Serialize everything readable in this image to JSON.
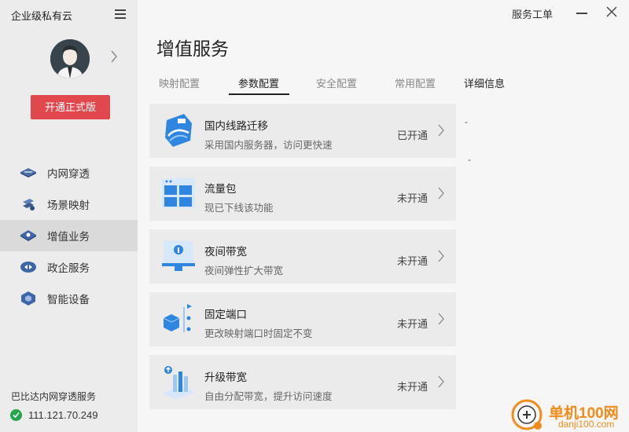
{
  "app": {
    "title": "企业级私有云"
  },
  "window": {
    "work_order": "服务工单"
  },
  "sidebar": {
    "upgrade_label": "开通正式版",
    "items": [
      {
        "label": "内网穿透",
        "icon": "network-tunnel-icon"
      },
      {
        "label": "场景映射",
        "icon": "scene-map-icon"
      },
      {
        "label": "增值业务",
        "icon": "value-added-icon",
        "active": true
      },
      {
        "label": "政企服务",
        "icon": "enterprise-service-icon"
      },
      {
        "label": "智能设备",
        "icon": "smart-device-icon"
      }
    ],
    "service_name": "巴比达内网穿透服务",
    "ip": "111.121.70.249"
  },
  "main": {
    "title": "增值服务",
    "tabs": [
      {
        "label": "映射配置"
      },
      {
        "label": "参数配置",
        "active": true
      },
      {
        "label": "安全配置"
      },
      {
        "label": "常用配置"
      },
      {
        "label": "详细信息"
      }
    ],
    "cards": [
      {
        "title": "国内线路迁移",
        "desc": "采用国内服务器，访问更快速",
        "status": "已开通",
        "icon": "domestic-route-icon"
      },
      {
        "title": "流量包",
        "desc": "现已下线该功能",
        "status": "未开通",
        "icon": "traffic-package-icon"
      },
      {
        "title": "夜间带宽",
        "desc": "夜间弹性扩大带宽",
        "status": "未开通",
        "icon": "night-bandwidth-icon"
      },
      {
        "title": "固定端口",
        "desc": "更改映射端口时固定不变",
        "status": "未开通",
        "icon": "fixed-port-icon"
      },
      {
        "title": "升级带宽",
        "desc": "自由分配带宽，提升访问速度",
        "status": "未开通",
        "icon": "upgrade-bandwidth-icon"
      }
    ],
    "detail_dashes": [
      "-",
      "-"
    ]
  },
  "watermark": {
    "name": "单机100网",
    "url": "danji100.com"
  },
  "colors": {
    "accent": "#e0484e",
    "icon_blue": "#2f86e0",
    "online_green": "#23a54a"
  }
}
